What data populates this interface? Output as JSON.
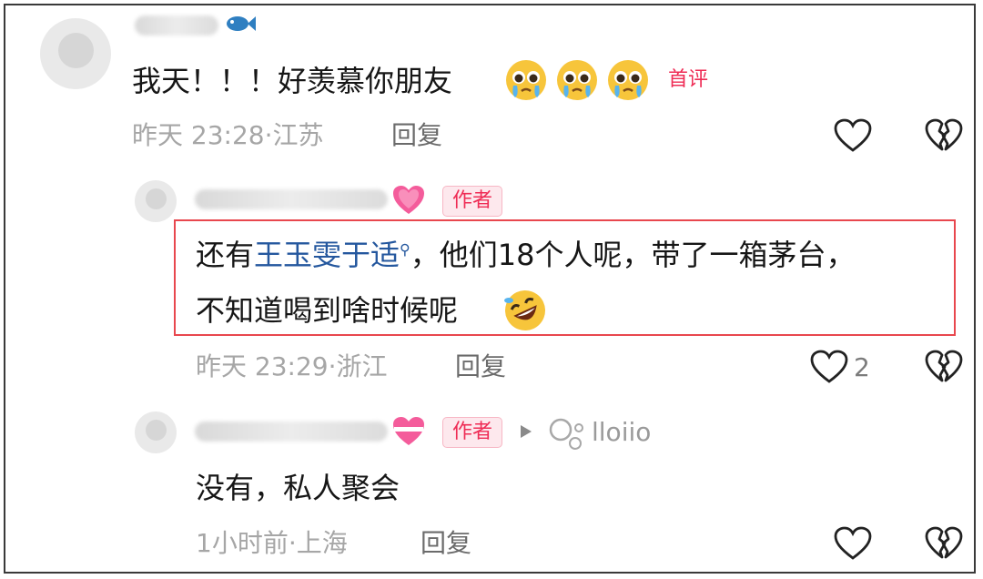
{
  "comments": [
    {
      "text": "我天！！！好羡慕你朋友",
      "first_tag": "首评",
      "time": "昨天 23:28·江苏",
      "reply": "回复"
    },
    {
      "author_tag": "作者",
      "text_prefix": "还有",
      "mention": "王玉雯于适",
      "text_rest": "，他们18个人呢，带了一箱茅台，",
      "text_line2": "不知道喝到啥时候呢",
      "time": "昨天 23:29·浙江",
      "reply": "回复",
      "like_count": "2"
    },
    {
      "author_tag": "作者",
      "reply_to_name": "lloiio",
      "text": "没有，私人聚会",
      "time": "1小时前·上海",
      "reply": "回复"
    }
  ],
  "colors": {
    "highlight_border": "#e8474e",
    "accent_pink": "#ef2c55",
    "mention_blue": "#24579e"
  }
}
